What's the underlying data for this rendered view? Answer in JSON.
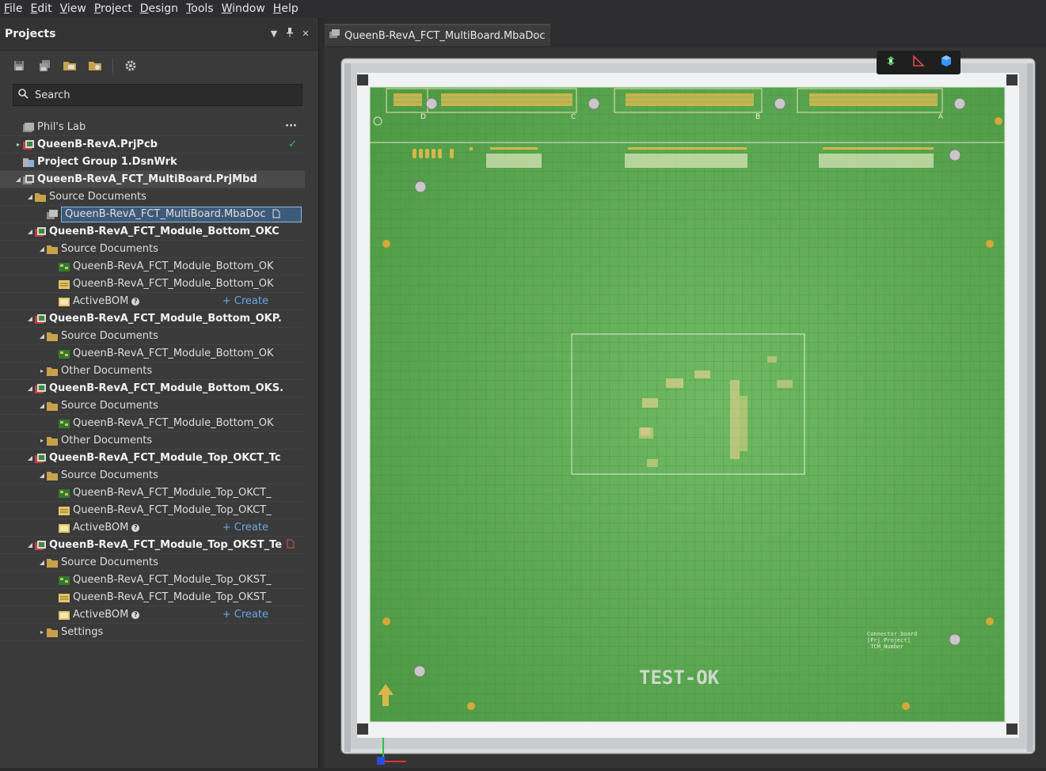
{
  "menu": [
    {
      "u": "F",
      "rest": "ile"
    },
    {
      "u": "E",
      "rest": "dit"
    },
    {
      "u": "V",
      "rest": "iew"
    },
    {
      "u": "P",
      "rest": "roject"
    },
    {
      "u": "D",
      "rest": "esign"
    },
    {
      "u": "T",
      "rest": "ools"
    },
    {
      "u": "W",
      "rest": "indow"
    },
    {
      "u": "H",
      "rest": "elp"
    }
  ],
  "panel": {
    "title": "Projects",
    "search_placeholder": "Search"
  },
  "tree": [
    {
      "indent": 0,
      "arrow": "",
      "icon": "workspace-icon",
      "label": "Phil's Lab",
      "bold": false,
      "extra": "more"
    },
    {
      "indent": 0,
      "arrow": "▸",
      "icon": "pcb-project-icon",
      "label": "QueenB-RevA.PrjPcb",
      "bold": true,
      "extra": "check"
    },
    {
      "indent": 0,
      "arrow": "",
      "icon": "project-group-icon",
      "label": "Project Group 1.DsnWrk",
      "bold": true
    },
    {
      "indent": 0,
      "arrow": "◢",
      "icon": "multiboard-project-icon",
      "label": "QueenB-RevA_FCT_MultiBoard.PrjMbd",
      "bold": true,
      "selected": true
    },
    {
      "indent": 1,
      "arrow": "◢",
      "icon": "folder-icon",
      "label": "Source Documents"
    },
    {
      "indent": 2,
      "arrow": "",
      "icon": "multiboard-doc-icon",
      "label": "QueenB-RevA_FCT_MultiBoard.MbaDoc",
      "seldoc": true
    },
    {
      "indent": 1,
      "arrow": "◢",
      "icon": "pcb-project-icon",
      "label": "QueenB-RevA_FCT_Module_Bottom_OKC",
      "bold": true
    },
    {
      "indent": 2,
      "arrow": "◢",
      "icon": "folder-icon",
      "label": "Source Documents"
    },
    {
      "indent": 3,
      "arrow": "",
      "icon": "pcb-doc-icon",
      "label": "QueenB-RevA_FCT_Module_Bottom_OK"
    },
    {
      "indent": 3,
      "arrow": "",
      "icon": "schematic-doc-icon",
      "label": "QueenB-RevA_FCT_Module_Bottom_OK"
    },
    {
      "indent": 3,
      "arrow": "",
      "icon": "bom-icon",
      "label": "ActiveBOM",
      "help": true,
      "create": "+ Create"
    },
    {
      "indent": 1,
      "arrow": "◢",
      "icon": "pcb-project-icon",
      "label": "QueenB-RevA_FCT_Module_Bottom_OKP.",
      "bold": true
    },
    {
      "indent": 2,
      "arrow": "◢",
      "icon": "folder-icon",
      "label": "Source Documents"
    },
    {
      "indent": 3,
      "arrow": "",
      "icon": "pcb-doc-icon",
      "label": "QueenB-RevA_FCT_Module_Bottom_OK"
    },
    {
      "indent": 2,
      "arrow": "▸",
      "icon": "folder-icon",
      "label": "Other Documents"
    },
    {
      "indent": 1,
      "arrow": "◢",
      "icon": "pcb-project-icon",
      "label": "QueenB-RevA_FCT_Module_Bottom_OKS.",
      "bold": true
    },
    {
      "indent": 2,
      "arrow": "◢",
      "icon": "folder-icon",
      "label": "Source Documents"
    },
    {
      "indent": 3,
      "arrow": "",
      "icon": "pcb-doc-icon",
      "label": "QueenB-RevA_FCT_Module_Bottom_OK"
    },
    {
      "indent": 2,
      "arrow": "▸",
      "icon": "folder-icon",
      "label": "Other Documents"
    },
    {
      "indent": 1,
      "arrow": "◢",
      "icon": "pcb-project-icon",
      "label": "QueenB-RevA_FCT_Module_Top_OKCT_Tc",
      "bold": true
    },
    {
      "indent": 2,
      "arrow": "◢",
      "icon": "folder-icon",
      "label": "Source Documents"
    },
    {
      "indent": 3,
      "arrow": "",
      "icon": "pcb-doc-icon",
      "label": "QueenB-RevA_FCT_Module_Top_OKCT_"
    },
    {
      "indent": 3,
      "arrow": "",
      "icon": "schematic-doc-icon",
      "label": "QueenB-RevA_FCT_Module_Top_OKCT_"
    },
    {
      "indent": 3,
      "arrow": "",
      "icon": "bom-icon",
      "label": "ActiveBOM",
      "help": true,
      "create": "+ Create"
    },
    {
      "indent": 1,
      "arrow": "◢",
      "icon": "pcb-project-icon",
      "label": "QueenB-RevA_FCT_Module_Top_OKST_Te",
      "bold": true,
      "modified": true
    },
    {
      "indent": 2,
      "arrow": "◢",
      "icon": "folder-icon",
      "label": "Source Documents"
    },
    {
      "indent": 3,
      "arrow": "",
      "icon": "pcb-doc-icon",
      "label": "QueenB-RevA_FCT_Module_Top_OKST_"
    },
    {
      "indent": 3,
      "arrow": "",
      "icon": "schematic-doc-icon",
      "label": "QueenB-RevA_FCT_Module_Top_OKST_"
    },
    {
      "indent": 3,
      "arrow": "",
      "icon": "bom-icon",
      "label": "ActiveBOM",
      "help": true,
      "create": "+ Create"
    },
    {
      "indent": 2,
      "arrow": "▸",
      "icon": "folder-icon",
      "label": "Settings"
    }
  ],
  "document": {
    "tab_label": "QueenB-RevA_FCT_MultiBoard.MbaDoc",
    "board_logo": "TEST-OK",
    "connector_labels": [
      "D",
      "C",
      "B",
      "A"
    ],
    "side_note_lines": [
      "Connector board",
      "[Prj.Project]",
      ".TCM_Number"
    ]
  },
  "colors": {
    "board_green": "#5aa84f",
    "frame": "#d8dcde",
    "accent_blue": "#3399ff"
  }
}
